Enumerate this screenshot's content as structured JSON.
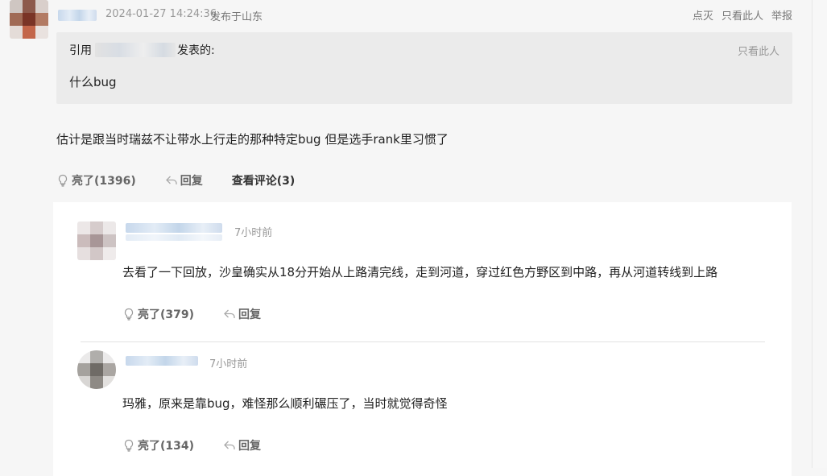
{
  "post": {
    "timestamp": "2024-01-27 14:24:36",
    "location": "发布于山东",
    "actions": [
      "点灭",
      "只看此人",
      "举报"
    ],
    "quote": {
      "prefix": "引用",
      "suffix": "发表的:",
      "only_this_user": "只看此人",
      "text": "什么bug"
    },
    "reply_text": "估计是跟当时瑞兹不让带水上行走的那种特定bug 但是选手rank里习惯了",
    "footer": {
      "likes": "亮了(1396)",
      "reply": "回复",
      "view_comments": "查看评论(3)"
    }
  },
  "comments": [
    {
      "time": "7小时前",
      "text": "去看了一下回放，沙皇确实从18分开始从上路清完线，走到河道，穿过红色方野区到中路，再从河道转线到上路",
      "likes": "亮了(379)",
      "reply": "回复"
    },
    {
      "time": "7小时前",
      "text": "玛雅，原来是靠bug，难怪那么顺利碾压了，当时就觉得奇怪",
      "likes": "亮了(134)",
      "reply": "回复"
    }
  ],
  "colors": {
    "meta": "#999999",
    "quote_bg": "#ebebeb",
    "page_bg": "#f6f6f6"
  },
  "icons": [
    "lightbulb-icon",
    "reply-arrow-icon"
  ]
}
